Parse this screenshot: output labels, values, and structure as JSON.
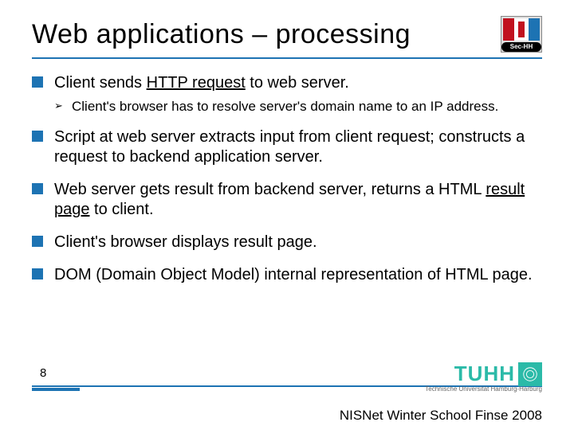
{
  "title": "Web applications – processing",
  "badge_label": "Sec-HH",
  "bullets": [
    {
      "text_parts": [
        "Client sends ",
        "HTTP request",
        " to web server."
      ],
      "underline_index": 1,
      "sub": [
        "Client's browser has to resolve server's domain name to an IP address."
      ]
    },
    {
      "text_parts": [
        "Script at web server extracts input from client request; constructs a request to backend application server."
      ]
    },
    {
      "text_parts": [
        "Web server gets result from backend server, returns a HTML ",
        "result page",
        " to client."
      ],
      "underline_index": 1
    },
    {
      "text_parts": [
        "Client's browser displays result page."
      ]
    },
    {
      "text_parts": [
        "DOM (Domain Object Model) internal representation of HTML page."
      ]
    }
  ],
  "page_number": "8",
  "logo_text": "TUHH",
  "logo_subtext": "Technische Universität Hamburg-Harburg",
  "conference": "NISNet Winter School Finse 2008"
}
